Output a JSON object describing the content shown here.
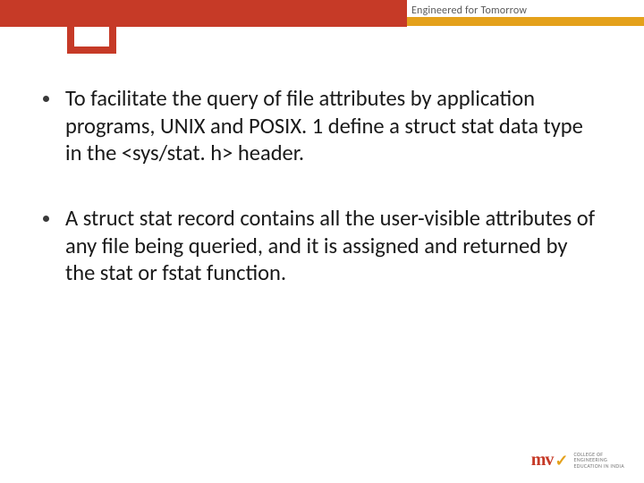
{
  "header": {
    "tagline": "Engineered for Tomorrow"
  },
  "bullets": [
    "To facilitate the query of file attributes by application programs, UNIX and POSIX. 1 define a struct stat data type in the <sys/stat. h> header.",
    "A struct stat record contains all the user-visible attributes of any file being queried, and it is assigned and returned by the stat or fstat function."
  ],
  "logo": {
    "mark": "mv",
    "line1": "COLLEGE OF",
    "line2": "ENGINEERING",
    "line3": "EDUCATION IN INDIA"
  }
}
